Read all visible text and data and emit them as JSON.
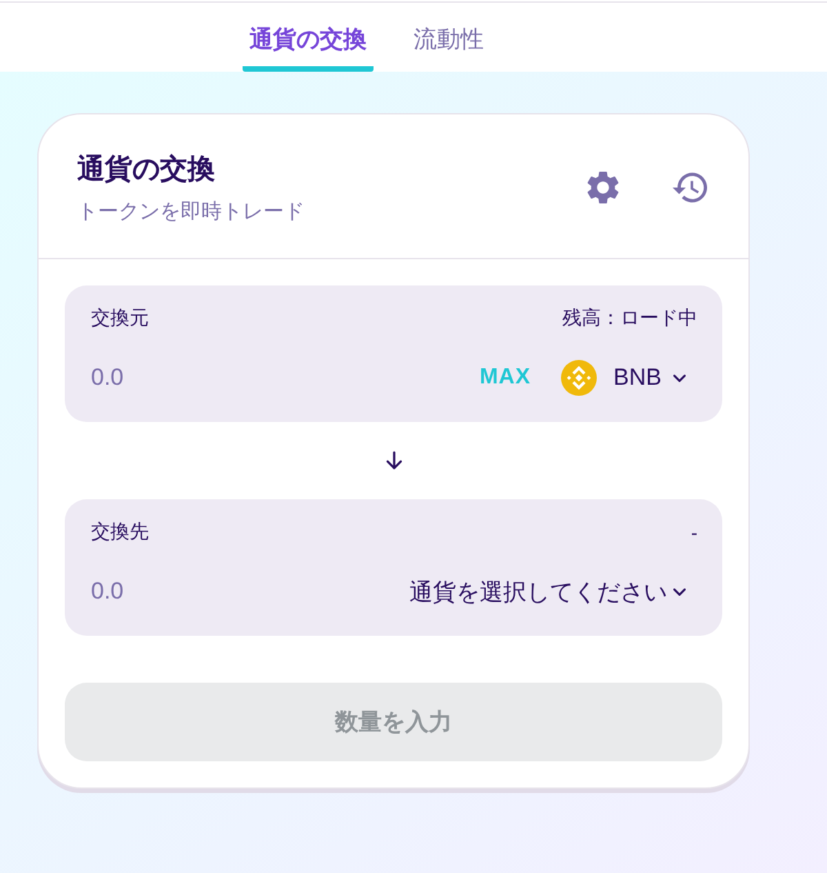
{
  "nav": {
    "tabs": [
      {
        "label": "通貨の交換",
        "selected": true
      },
      {
        "label": "流動性",
        "selected": false
      }
    ]
  },
  "card": {
    "title": "通貨の交換",
    "subtitle": "トークンを即時トレード"
  },
  "panels": [
    {
      "label": "交換元",
      "info": "残高：ロード中",
      "amount": {
        "placeholder": "0.0"
      },
      "max_button": "MAX",
      "currency": {
        "kind": "token",
        "label": "BNB"
      }
    },
    {
      "label": "交換先",
      "info": "-",
      "amount": {
        "placeholder": "0.0"
      },
      "currency": {
        "kind": "prompt",
        "label": "通貨を選択してください"
      }
    }
  ],
  "submit": {
    "label": "数量を入力",
    "disabled": true
  }
}
